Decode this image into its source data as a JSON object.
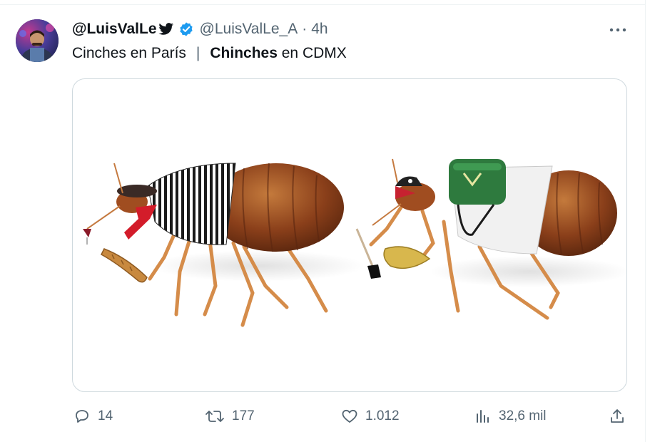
{
  "tweet": {
    "display_name": "@LuisValLe",
    "handle": "@LuisValLe_A",
    "separator": "·",
    "time": "4h",
    "text_part1": "Cinches en París",
    "text_separator": "|",
    "text_bold": "Chinches",
    "text_part2": " en CDMX"
  },
  "icons": {
    "bird": "bird-icon",
    "verified": "verified-badge-icon",
    "more": "more-options-icon",
    "reply": "reply-icon",
    "retweet": "retweet-icon",
    "like": "like-icon",
    "views": "views-icon",
    "share": "share-icon"
  },
  "actions": {
    "replies": "14",
    "retweets": "177",
    "likes": "1.012",
    "views": "32,6 mil"
  },
  "colors": {
    "verified": "#1d9bf0",
    "muted": "#536471",
    "text": "#0f1419",
    "border": "#cfd9de"
  }
}
